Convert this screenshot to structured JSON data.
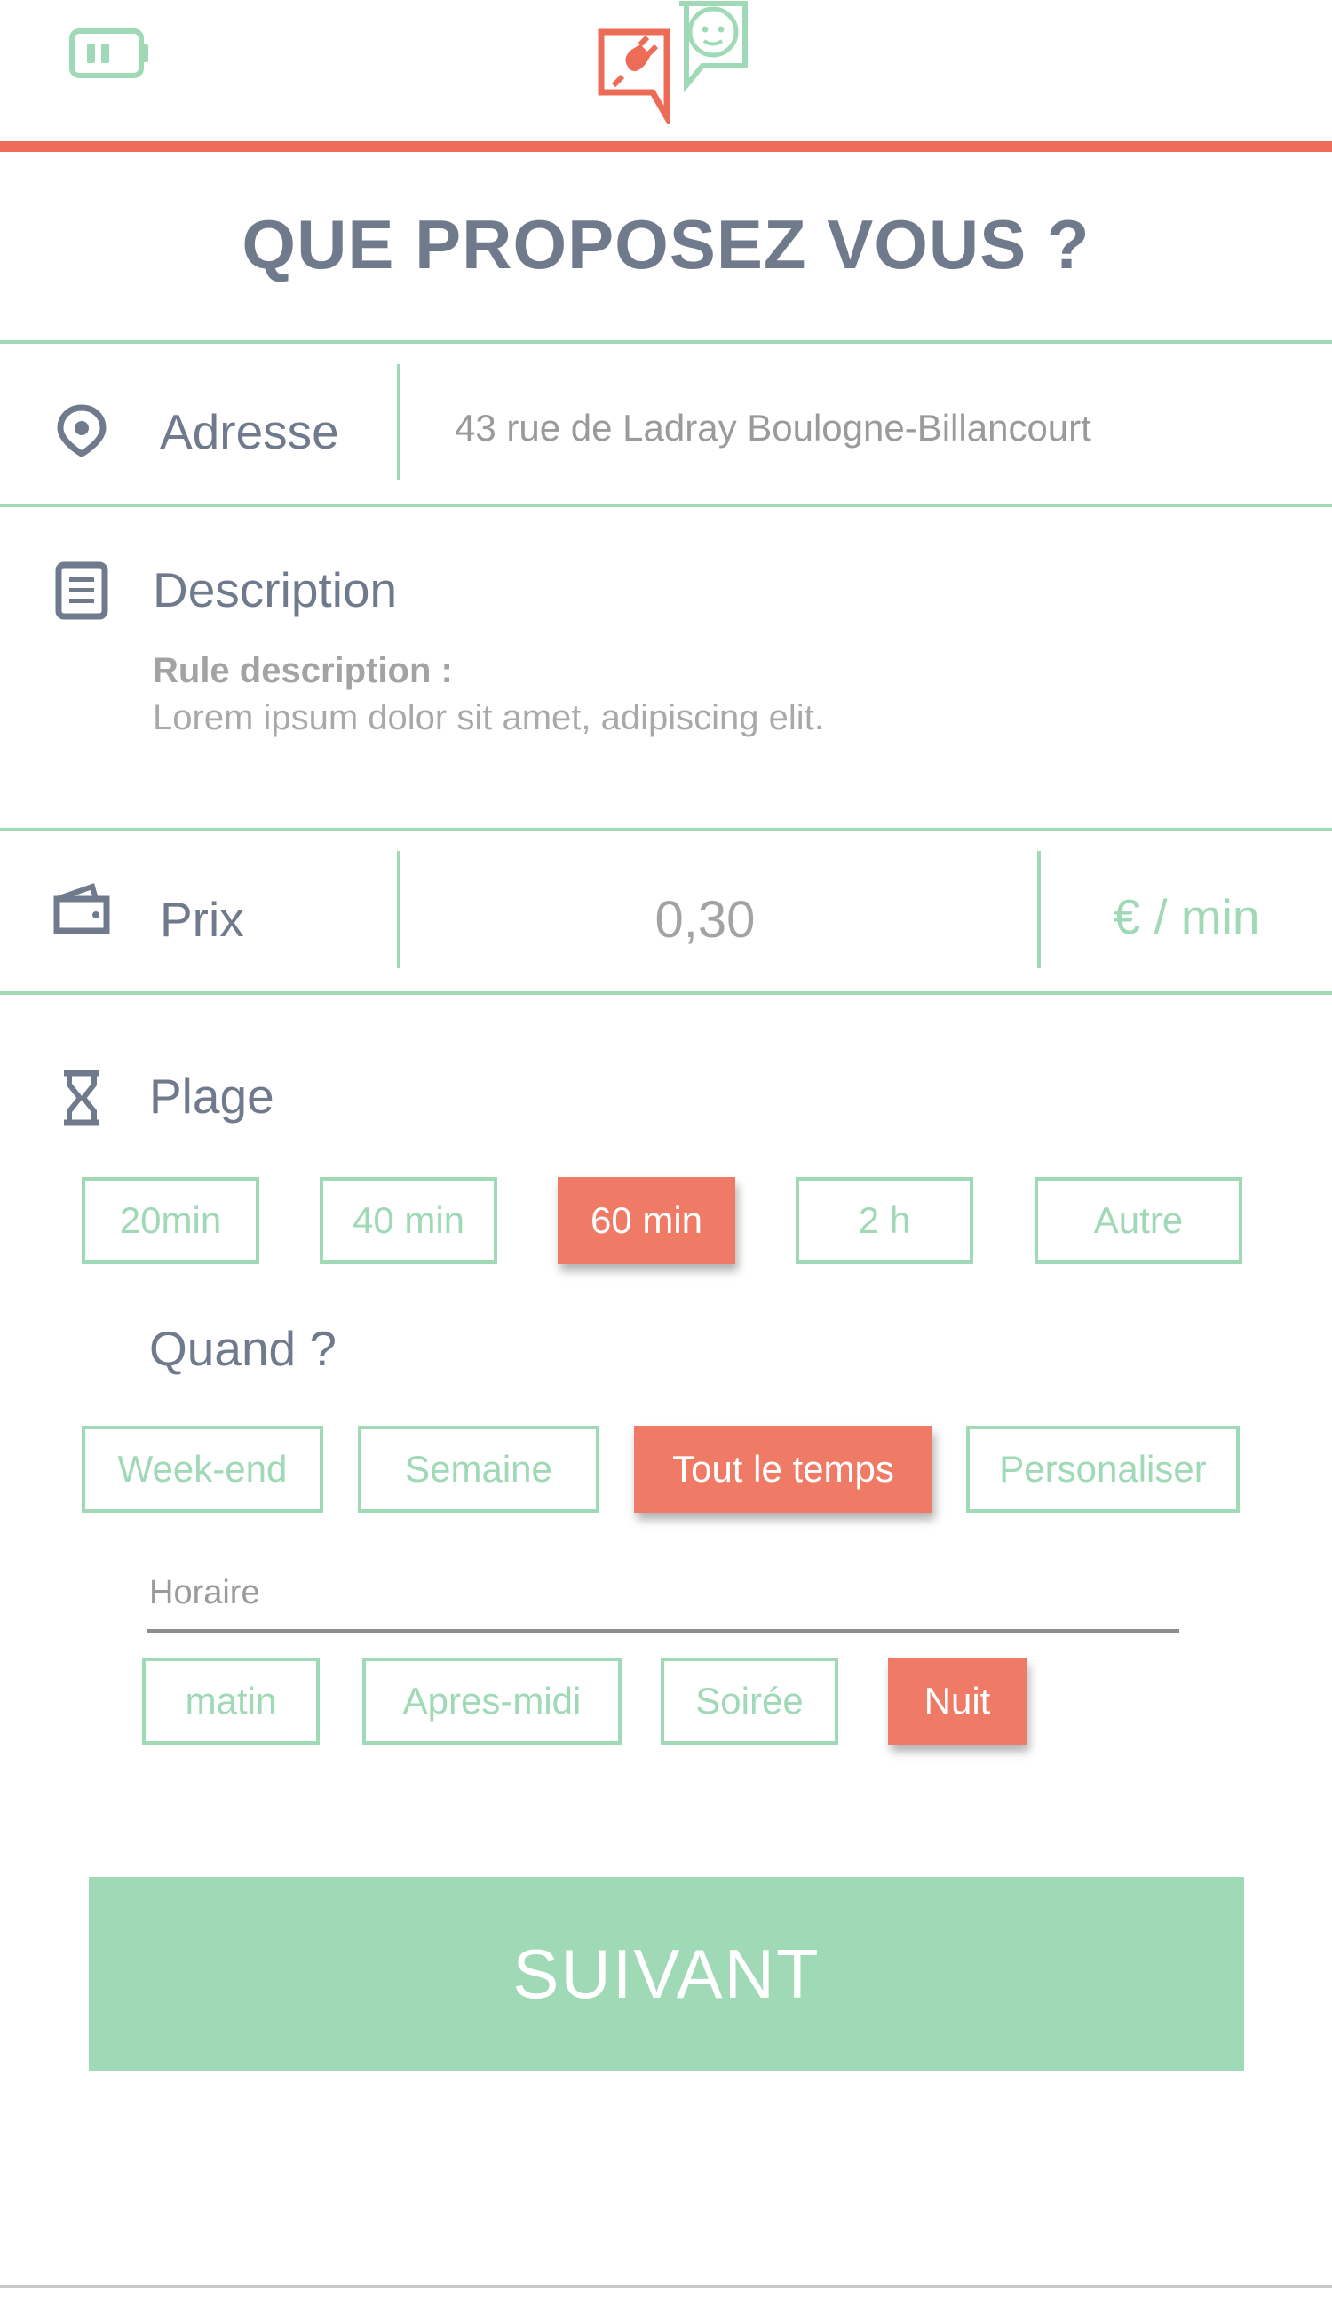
{
  "header": {
    "battery_icon": "battery-icon",
    "logo_icons": [
      "plug-bubble-icon",
      "socket-bubble-icon"
    ],
    "accent_color": "#ec6c57",
    "brand_green": "#9fd9b5"
  },
  "page_title": "QUE PROPOSEZ VOUS ?",
  "address": {
    "icon": "location-pin-icon",
    "label": "Adresse",
    "value": "43 rue de Ladray Boulogne-Billancourt"
  },
  "description": {
    "icon": "document-icon",
    "label": "Description",
    "subtitle": "Rule description :",
    "body": "Lorem ipsum dolor sit amet, adipiscing elit."
  },
  "price": {
    "icon": "wallet-icon",
    "label": "Prix",
    "value": "0,30",
    "unit": "€ / min"
  },
  "plage": {
    "icon": "hourglass-icon",
    "label": "Plage",
    "options": [
      "20min",
      "40 min",
      "60 min",
      "2 h",
      "Autre"
    ],
    "selected": "60 min"
  },
  "quand": {
    "label": "Quand ?",
    "options": [
      "Week-end",
      "Semaine",
      "Tout le temps",
      "Personaliser"
    ],
    "selected": "Tout le temps"
  },
  "horaire": {
    "label": "Horaire",
    "options": [
      "matin",
      "Apres-midi",
      "Soirée",
      "Nuit"
    ],
    "selected": "Nuit"
  },
  "submit": {
    "label": "SUIVANT"
  }
}
